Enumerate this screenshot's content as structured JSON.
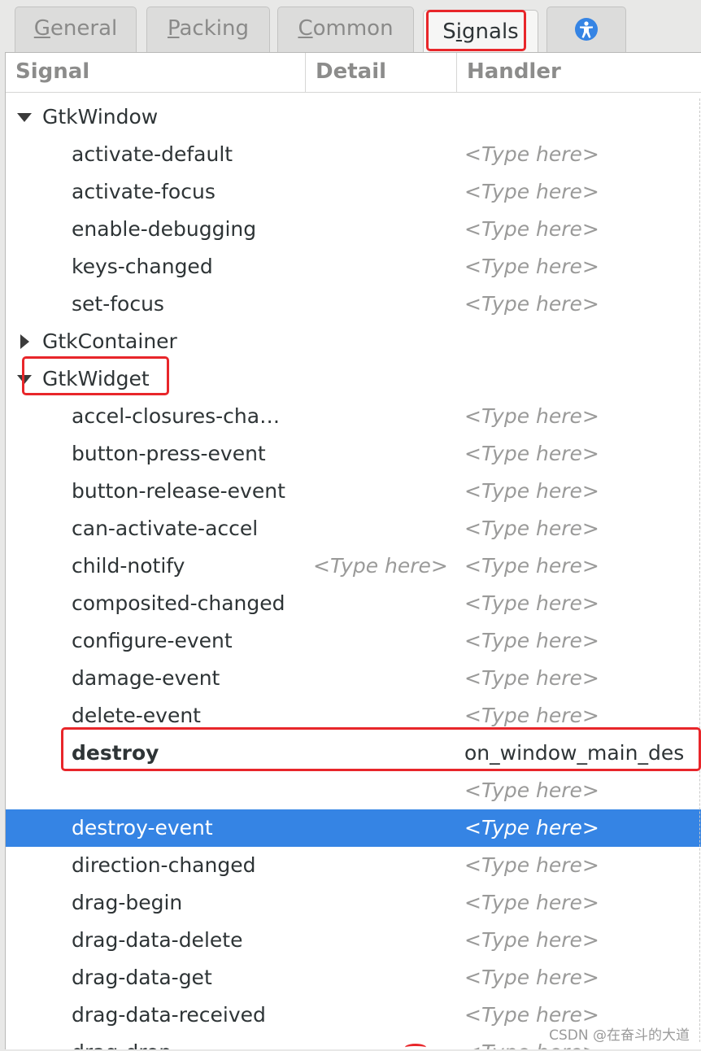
{
  "tabs": [
    {
      "label_pre": "",
      "mnemonic": "G",
      "label_post": "eneral"
    },
    {
      "label_pre": "",
      "mnemonic": "P",
      "label_post": "acking"
    },
    {
      "label_pre": "",
      "mnemonic": "C",
      "label_post": "ommon"
    },
    {
      "label_pre": "S",
      "mnemonic": "i",
      "label_post": "gnals"
    }
  ],
  "active_tab": "Signals",
  "columns": {
    "signal": "Signal",
    "detail": "Detail",
    "handler": "Handler"
  },
  "placeholder": "<Type here>",
  "groups": {
    "window": {
      "name": "GtkWindow",
      "expanded": true
    },
    "container": {
      "name": "GtkContainer",
      "expanded": false
    },
    "widget": {
      "name": "GtkWidget",
      "expanded": true
    }
  },
  "window_signals": [
    "activate-default",
    "activate-focus",
    "enable-debugging",
    "keys-changed",
    "set-focus"
  ],
  "widget_signals": [
    "accel-closures-cha…",
    "button-press-event",
    "button-release-event",
    "can-activate-accel",
    "child-notify",
    "composited-changed",
    "configure-event",
    "damage-event",
    "delete-event",
    "destroy",
    "destroy-event",
    "direction-changed",
    "drag-begin",
    "drag-data-delete",
    "drag-data-get",
    "drag-data-received",
    "drag-drop"
  ],
  "destroy_handler": "on_window_main_des",
  "selected_signal": "destroy-event",
  "watermark": "CSDN @在奋斗的大道",
  "colors": {
    "selection": "#3584e4",
    "annotation": "#e8262a"
  }
}
